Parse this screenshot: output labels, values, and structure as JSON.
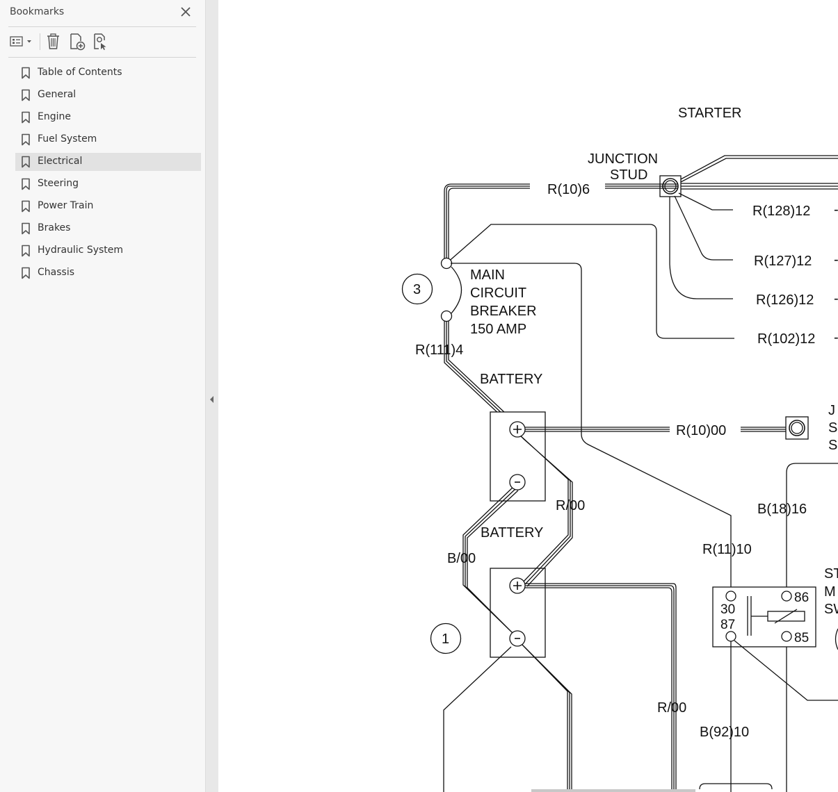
{
  "sidebar": {
    "title": "Bookmarks",
    "items": [
      {
        "label": "Table of Contents"
      },
      {
        "label": "General"
      },
      {
        "label": "Engine"
      },
      {
        "label": "Fuel System"
      },
      {
        "label": "Electrical",
        "selected": true
      },
      {
        "label": "Steering"
      },
      {
        "label": "Power Train"
      },
      {
        "label": "Brakes"
      },
      {
        "label": "Hydraulic System"
      },
      {
        "label": "Chassis"
      }
    ]
  },
  "toolbar": {
    "icons": [
      "options-icon",
      "delete-bookmark-icon",
      "new-bookmark-icon",
      "find-bookmark-icon"
    ]
  },
  "schematic": {
    "starter": "STARTER",
    "junction_stud_1": "JUNCTION",
    "junction_stud_2": "STUD",
    "w_r10_6": "R(10)6",
    "w_r128_12": "R(128)12",
    "w_r127_12": "R(127)12",
    "w_r126_12": "R(126)12",
    "w_r102_12": "R(102)12",
    "callout_3": "3",
    "mcb_1": "MAIN",
    "mcb_2": "CIRCUIT",
    "mcb_3": "BREAKER",
    "mcb_4": "150 AMP",
    "w_r111_4": "R(111)4",
    "battery_top": "BATTERY",
    "battery_bottom": "BATTERY",
    "w_r10_00": "R(10)00",
    "w_r_00_a": "R/00",
    "w_b_00": "B/00",
    "w_b18_16": "B(18)16",
    "w_r11_10": "R(11)10",
    "callout_1": "1",
    "w_r_00_b": "R/00",
    "w_b92_10": "B(92)10",
    "relay_30": "30",
    "relay_87": "87",
    "relay_86": "86",
    "relay_85": "85",
    "clip_j": "J",
    "clip_s1": "S",
    "clip_s2": "S",
    "clip_st": "ST",
    "clip_m": "M",
    "clip_sw": "SW",
    "dash": "-"
  }
}
